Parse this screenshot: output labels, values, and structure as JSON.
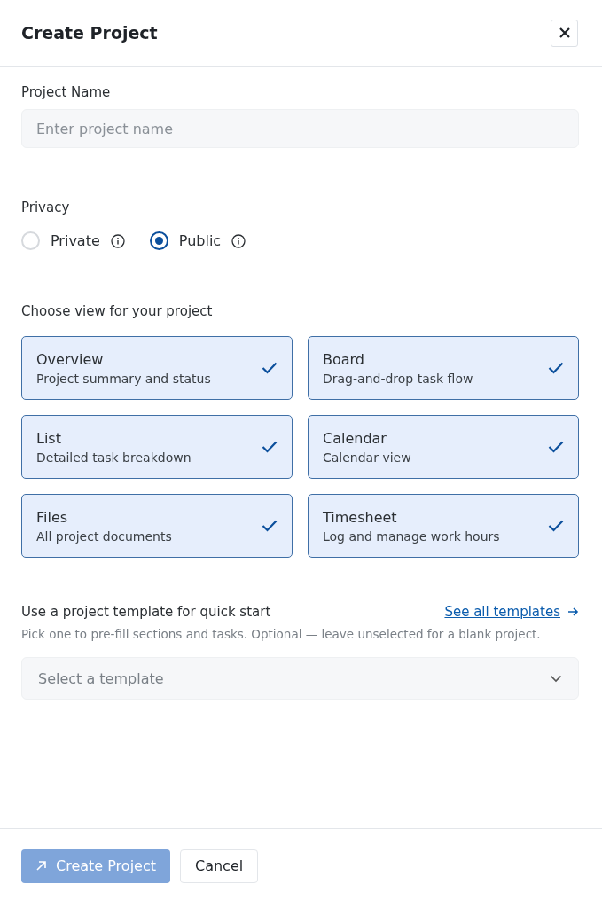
{
  "dialog": {
    "title": "Create Project"
  },
  "name_field": {
    "label": "Project Name",
    "placeholder": "Enter project name"
  },
  "privacy": {
    "label": "Privacy",
    "options": [
      {
        "label": "Private",
        "selected": false
      },
      {
        "label": "Public",
        "selected": true
      }
    ]
  },
  "views": {
    "label": "Choose view for your project",
    "items": [
      {
        "title": "Overview",
        "description": "Project summary and status",
        "checked": true
      },
      {
        "title": "Board",
        "description": "Drag-and-drop task flow",
        "checked": true
      },
      {
        "title": "List",
        "description": "Detailed task breakdown",
        "checked": true
      },
      {
        "title": "Calendar",
        "description": "Calendar view",
        "checked": true
      },
      {
        "title": "Files",
        "description": "All project documents",
        "checked": true
      },
      {
        "title": "Timesheet",
        "description": "Log and manage work hours",
        "checked": true
      }
    ]
  },
  "template": {
    "label": "Use a project template for quick start",
    "link": "See all templates",
    "hint": "Pick one to pre-fill sections and tasks. Optional — leave unselected for a blank project.",
    "placeholder": "Select a template"
  },
  "buttons": [
    {
      "label": "Create Project",
      "kind": "primary",
      "disabled": true
    },
    {
      "label": "Cancel",
      "kind": "secondary",
      "disabled": false
    }
  ]
}
